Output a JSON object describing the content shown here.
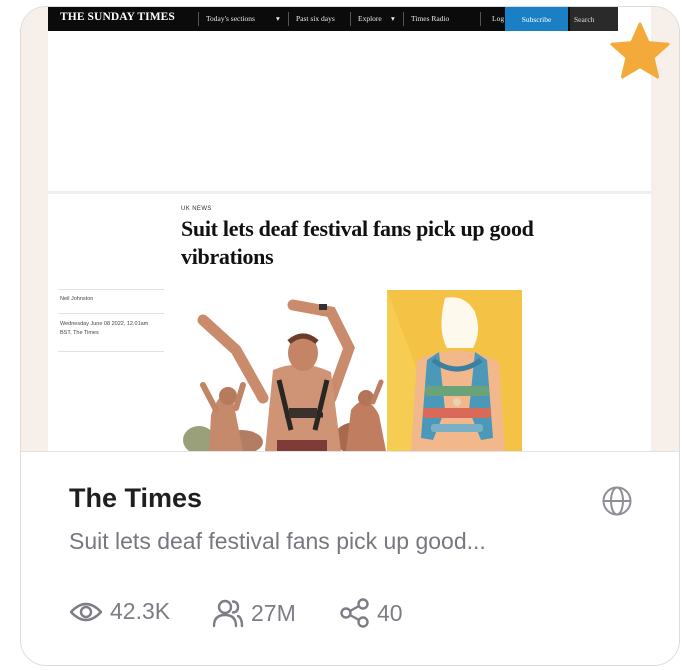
{
  "article_preview": {
    "masthead": "THE SUNDAY TIMES",
    "nav": [
      "Today's sections",
      "Past six days",
      "Explore",
      "Times Radio"
    ],
    "login": "Log in",
    "subscribe": "Subscribe",
    "search": "Search",
    "section_tag": "UK NEWS",
    "headline": "Suit lets deaf festival fans pick up good vibrations",
    "byline": "Neil Johnston",
    "dateline": "Wednesday June 08 2022, 12.01am BST, The Times"
  },
  "card": {
    "favorite_icon": "star-icon",
    "favorite_color": "#F4AA3A",
    "site_name": "The Times",
    "site_icon": "globe-icon",
    "description": "Suit lets deaf festival fans pick up good...",
    "stats": {
      "views": "42.3K",
      "audience": "27M",
      "shares": "40"
    }
  }
}
